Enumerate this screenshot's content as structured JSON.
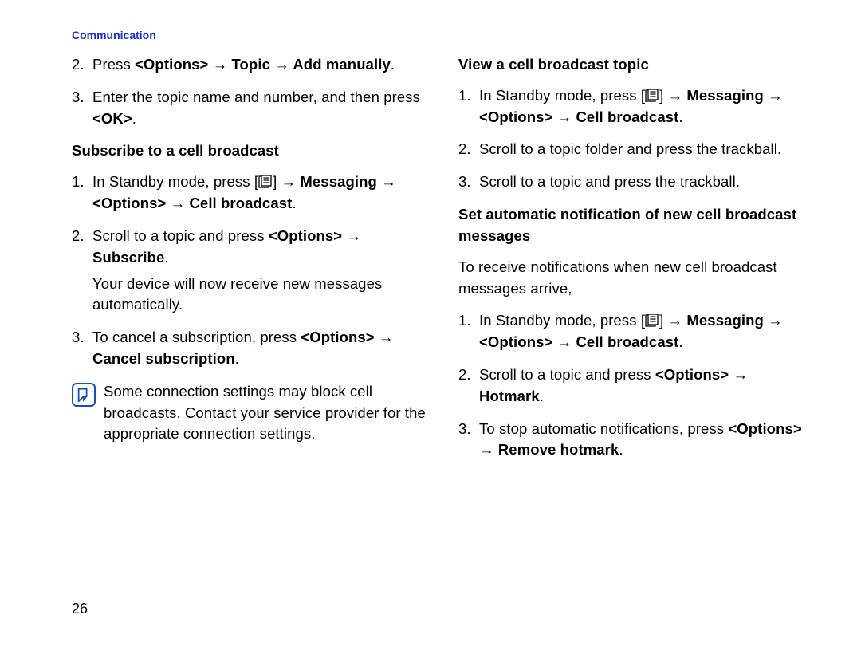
{
  "section_title": "Communication",
  "page_number": "26",
  "left": {
    "step2": {
      "num": "2.",
      "pre": "Press ",
      "path": "<Options> → Topic → Add manually",
      "post": "."
    },
    "step3": {
      "num": "3.",
      "pre": "Enter the topic name and number, and then press ",
      "bold": "<OK>",
      "post": "."
    },
    "hdr1": "Subscribe to a cell broadcast",
    "sub_step1": {
      "num": "1.",
      "pre": "In Standby mode, press [",
      "after_icon": "] → ",
      "path": "Messaging → <Options> → Cell broadcast",
      "post": "."
    },
    "sub_step2": {
      "num": "2.",
      "pre": "Scroll to a topic and press ",
      "bold1": "<Options>",
      "arrow": " → ",
      "bold2": "Subscribe",
      "post": ".",
      "result": "Your device will now receive new messages automatically."
    },
    "sub_step3": {
      "num": "3.",
      "pre": "To cancel a subscription, press ",
      "bold": "<Options> → Cancel subscription",
      "post": "."
    },
    "note": "Some connection settings may block cell broadcasts. Contact your service provider for the appropriate connection settings."
  },
  "right": {
    "hdr1": "View a cell broadcast topic",
    "v_step1": {
      "num": "1.",
      "pre": "In Standby mode, press [",
      "after_icon": "] → ",
      "path": "Messaging → <Options> → Cell broadcast",
      "post": "."
    },
    "v_step2": {
      "num": "2.",
      "text": "Scroll to a topic folder and press the trackball."
    },
    "v_step3": {
      "num": "3.",
      "text": "Scroll to a topic and press the trackball."
    },
    "hdr2": "Set automatic notification of new cell broadcast messages",
    "intro": "To receive notifications when new cell broadcast messages arrive,",
    "a_step1": {
      "num": "1.",
      "pre": "In Standby mode, press [",
      "after_icon": "] → ",
      "path": "Messaging → <Options> → Cell broadcast",
      "post": "."
    },
    "a_step2": {
      "num": "2.",
      "pre": "Scroll to a topic and press ",
      "bold1": "<Options>",
      "arrow": " → ",
      "bold2": "Hotmark",
      "post": "."
    },
    "a_step3": {
      "num": "3.",
      "pre": "To stop automatic notifications, press ",
      "bold": "<Options> → Remove hotmark",
      "post": "."
    }
  }
}
